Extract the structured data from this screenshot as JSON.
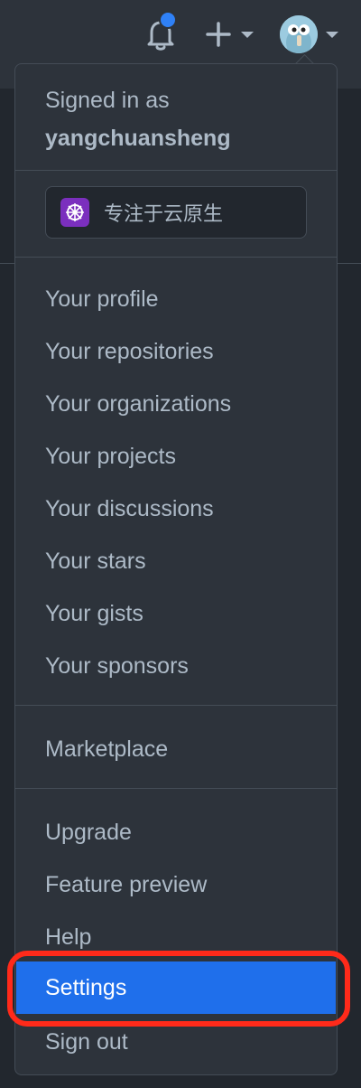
{
  "header": {
    "icons": [
      "bell-icon",
      "plus-icon",
      "chevron-down-icon",
      "avatar"
    ],
    "notification_dot_color": "#2f81f7"
  },
  "account": {
    "signed_in_label": "Signed in as",
    "username": "yangchuansheng"
  },
  "status": {
    "emoji_icon": "kubernetes-wheel-icon",
    "text": "专注于云原生"
  },
  "menu": {
    "group_personal": [
      "Your profile",
      "Your repositories",
      "Your organizations",
      "Your projects",
      "Your discussions",
      "Your stars",
      "Your gists",
      "Your sponsors"
    ],
    "group_marketplace": [
      "Marketplace"
    ],
    "group_settings": [
      "Upgrade",
      "Feature preview",
      "Help",
      "Settings",
      "Sign out"
    ]
  },
  "colors": {
    "background": "#22272e",
    "menu_background": "#2d333b",
    "text": "#adbac7",
    "active_item": "#1f6feb",
    "annotation_ring": "#ff2a1a"
  }
}
